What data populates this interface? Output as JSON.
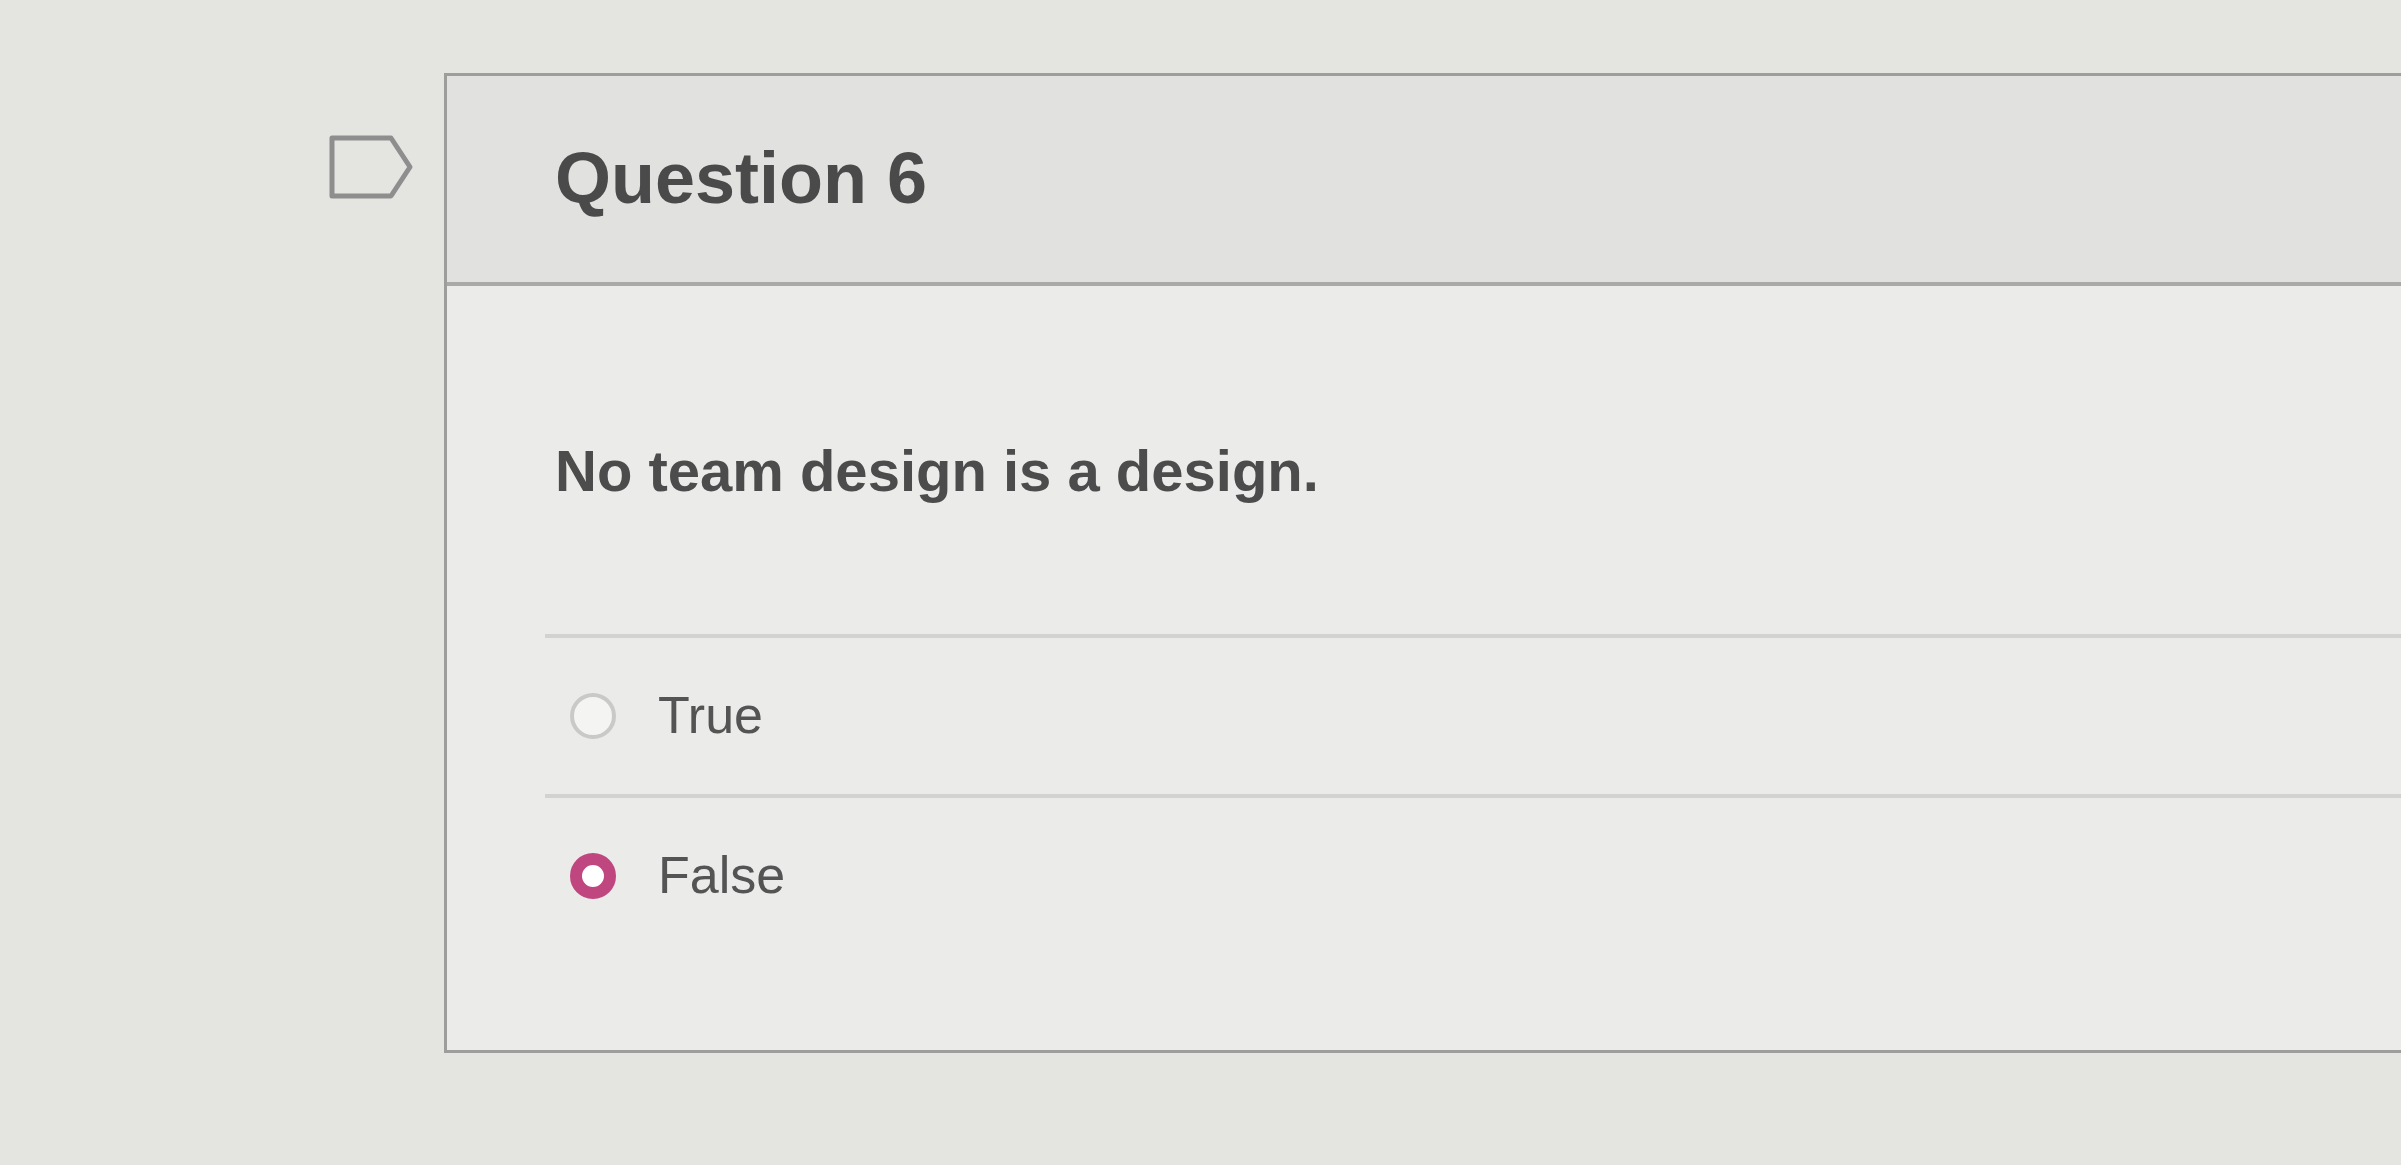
{
  "question": {
    "flagged": false,
    "title": "Question 6",
    "text": "No team design is a design."
  },
  "answers": [
    {
      "label": "True",
      "selected": false
    },
    {
      "label": "False",
      "selected": true
    }
  ]
}
